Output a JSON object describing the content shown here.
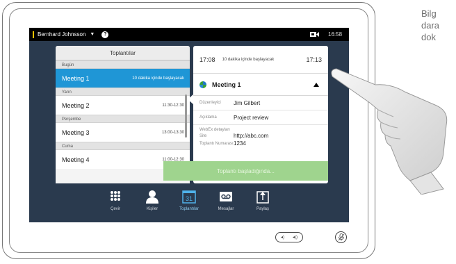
{
  "status_bar": {
    "user": "Bernhard Johnsson",
    "caret": "▼",
    "help": "?",
    "time": "16:58",
    "accent_color": "#f2c200"
  },
  "meetings": {
    "title": "Toplantılar",
    "groups": [
      {
        "day": "Bugün",
        "items": [
          {
            "name": "Meeting 1",
            "time": "10 dakika içinde başlayacak",
            "selected": true
          }
        ]
      },
      {
        "day": "Yarın",
        "items": [
          {
            "name": "Meeting 2",
            "time": "11:30-12:30",
            "selected": false
          }
        ]
      },
      {
        "day": "Perşembe",
        "items": [
          {
            "name": "Meeting 3",
            "time": "13:00-13:30",
            "selected": false
          }
        ]
      },
      {
        "day": "Cuma",
        "items": [
          {
            "name": "Meeting 4",
            "time": "11:00-12:30",
            "selected": false
          }
        ]
      }
    ],
    "selected_color": "#1f96d6"
  },
  "detail": {
    "start": "17:08",
    "status": "10 dakika içinde başlayacak",
    "end": "17:13",
    "title": "Meeting 1",
    "organizer_label": "Düzenleyici",
    "organizer": "Jim Gilbert",
    "description_label": "Açıklama",
    "description": "Project review",
    "webex_label": "WebEx detayları",
    "site_label": "Site",
    "site": "http://abc.com",
    "number_label": "Toplantı Numarası",
    "number": "1234",
    "start_button": "Toplantı başladığında...",
    "start_button_color": "#9fd48e"
  },
  "nav": {
    "items": [
      {
        "label": "Çevir",
        "icon": "dialpad-icon"
      },
      {
        "label": "Kişiler",
        "icon": "contacts-icon"
      },
      {
        "label": "Toplantılar",
        "icon": "calendar-icon",
        "day": "31",
        "active": true
      },
      {
        "label": "Mesajlar",
        "icon": "voicemail-icon"
      },
      {
        "label": "Paylaş",
        "icon": "share-icon"
      }
    ]
  },
  "hardware": {
    "vol_down": "◂)",
    "vol_up": "◂))"
  },
  "side_text": {
    "lines": [
      "Bilg",
      "dara",
      "dok"
    ]
  }
}
